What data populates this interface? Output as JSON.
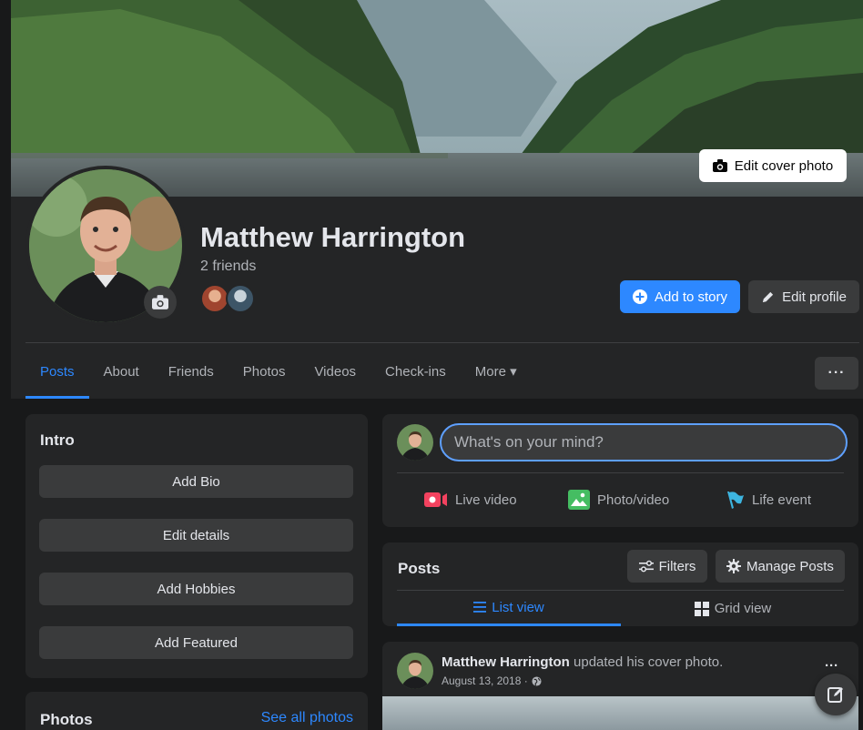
{
  "profile": {
    "name": "Matthew Harrington",
    "friends_count": "2 friends",
    "edit_cover_label": "Edit cover photo",
    "add_story_label": "Add to story",
    "edit_profile_label": "Edit profile"
  },
  "tabs": [
    {
      "label": "Posts",
      "active": true
    },
    {
      "label": "About"
    },
    {
      "label": "Friends"
    },
    {
      "label": "Photos"
    },
    {
      "label": "Videos"
    },
    {
      "label": "Check-ins"
    },
    {
      "label": "More ▾"
    }
  ],
  "more_dots": "···",
  "intro": {
    "title": "Intro",
    "buttons": [
      "Add Bio",
      "Edit details",
      "Add Hobbies",
      "Add Featured"
    ]
  },
  "photos": {
    "title": "Photos",
    "see_all": "See all photos"
  },
  "composer": {
    "placeholder": "What's on your mind?",
    "actions": [
      "Live video",
      "Photo/video",
      "Life event"
    ]
  },
  "posts_section": {
    "title": "Posts",
    "filters_label": "Filters",
    "manage_label": "Manage Posts",
    "list_view_label": "List view",
    "grid_view_label": "Grid view"
  },
  "post": {
    "author": "Matthew Harrington",
    "action": " updated his cover photo.",
    "date": "August 13, 2018 ·",
    "menu": "···"
  },
  "colors": {
    "accent": "#2d88ff",
    "background": "#18191a",
    "card": "#242526"
  }
}
